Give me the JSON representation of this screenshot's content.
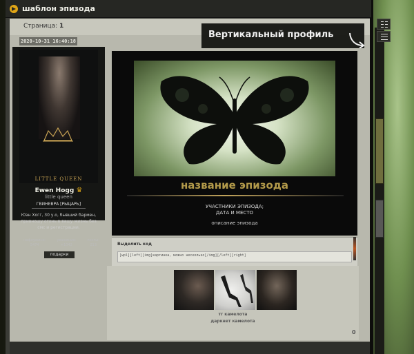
{
  "window": {
    "title": "шаблон эпизода"
  },
  "pagination": {
    "label": "Страница:",
    "page": "1"
  },
  "post": {
    "date": "2020-10-31 16:40:18",
    "author": {
      "logo_text": "LITTLE QUEEN",
      "name": "Ewen Hogg",
      "title": "little queen",
      "rank": "ГВИНЕВРА [РЫЦАРЬ]",
      "description": "Юэн Хогг, 30 у.о, бывший бармен, привношу огонь в вашу жизнь без смс и регистрации.",
      "stats": [
        {
          "label": "нафлужено:",
          "value": "5474"
        },
        {
          "label": "уважение:",
          "value": "+1042"
        },
        {
          "label": "посты:",
          "value": "213"
        }
      ],
      "gifts_label": "подарки"
    },
    "episode": {
      "title": "название эпизода",
      "participants": "УЧАСТНИКИ ЭПИЗОДА;",
      "date_place": "ДАТА И МЕСТО",
      "description": "описание эпизода"
    },
    "code": {
      "label": "Выделить код",
      "content": "[wpl][left][img]картинка, можно несколько[/img][/left][right]"
    },
    "links": [
      "тг камелота",
      "даркнет камелота"
    ],
    "counter": "0"
  },
  "tooltip": {
    "text": "Вертикальный профиль"
  },
  "icons": {
    "arrow": "curved-arrow-icon",
    "profile": "vertical-profile-icon",
    "menu": "menu-icon"
  },
  "colors": {
    "accent": "#e0a516",
    "episode_title": "#b39a4a"
  }
}
